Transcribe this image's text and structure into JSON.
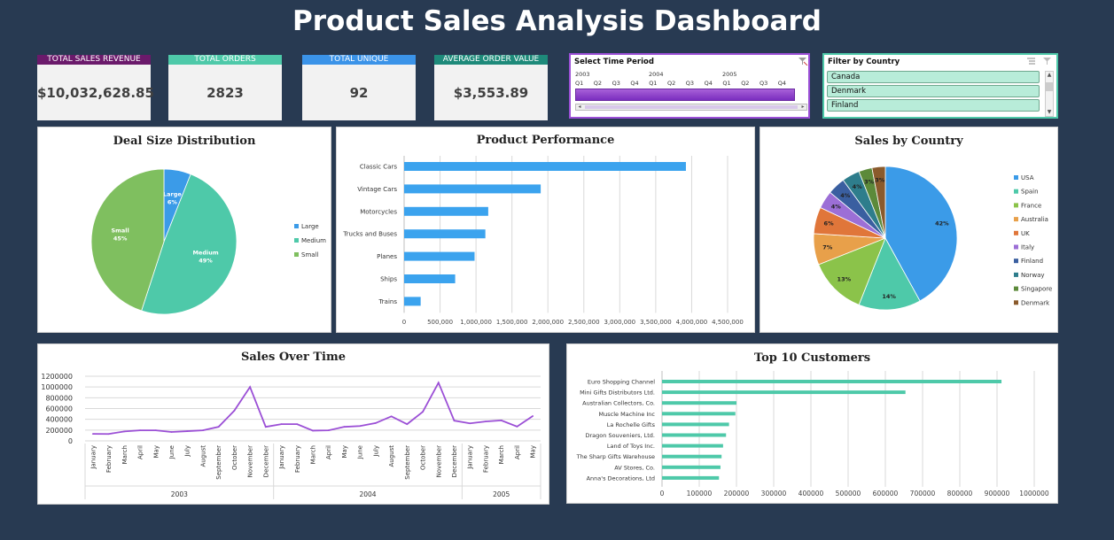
{
  "title": "Product Sales Analysis Dashboard",
  "kpis": [
    {
      "label": "TOTAL SALES REVENUE",
      "value": "$10,032,628.85",
      "color": "#6b1a6b"
    },
    {
      "label": "TOTAL ORDERS",
      "value": "2823",
      "color": "#4ec9a9"
    },
    {
      "label": "TOTAL UNIQUE",
      "value": "92",
      "color": "#3b93e8"
    },
    {
      "label": "AVERAGE ORDER VALUE",
      "value": "$3,553.89",
      "color": "#1e8a7a"
    }
  ],
  "time_slicer": {
    "title": "Select Time Period",
    "years": [
      "2003",
      "2004",
      "2005"
    ],
    "quarters": [
      "Q1",
      "Q2",
      "Q3",
      "Q4",
      "Q1",
      "Q2",
      "Q3",
      "Q4",
      "Q1",
      "Q2",
      "Q3",
      "Q4"
    ]
  },
  "country_slicer": {
    "title": "Filter by Country",
    "items": [
      "Canada",
      "Denmark",
      "Finland"
    ]
  },
  "chart_data": [
    {
      "type": "pie",
      "title": "Deal Size Distribution",
      "categories": [
        "Large",
        "Medium",
        "Small"
      ],
      "values": [
        6,
        49,
        45
      ],
      "data_labels": [
        "Large\n6%",
        "Medium\n49%",
        "Small\n45%"
      ],
      "colors": [
        "#3b9be8",
        "#4ec9a9",
        "#7fbf5f"
      ],
      "legend": "right"
    },
    {
      "type": "bar",
      "title": "Product Performance",
      "categories": [
        "Classic Cars",
        "Vintage Cars",
        "Motorcycles",
        "Trucks and Buses",
        "Planes",
        "Ships",
        "Trains"
      ],
      "values": [
        3920000,
        1900000,
        1170000,
        1130000,
        980000,
        710000,
        230000
      ],
      "xlim": [
        0,
        4500000
      ],
      "xticks": [
        "0",
        "500,000",
        "1,000,000",
        "1,500,000",
        "2,000,000",
        "2,500,000",
        "3,000,000",
        "3,500,000",
        "4,000,000",
        "4,500,000"
      ],
      "color": "#3ba3ee",
      "grid": true
    },
    {
      "type": "pie",
      "title": "Sales by Country",
      "categories": [
        "USA",
        "Spain",
        "France",
        "Australia",
        "UK",
        "Italy",
        "Finland",
        "Norway",
        "Singapore",
        "Denmark"
      ],
      "values": [
        42,
        14,
        13,
        7,
        6,
        4,
        4,
        4,
        3,
        3
      ],
      "data_labels": [
        "42%",
        "14%",
        "13%",
        "7%",
        "6%",
        "4%",
        "4%",
        "4%",
        "3%",
        "3%"
      ],
      "colors": [
        "#3b9be8",
        "#4ec9a9",
        "#8bc34a",
        "#e8a04a",
        "#e0763a",
        "#9c6fd6",
        "#3a5fa0",
        "#2e7d8c",
        "#5c8a3a",
        "#8a5a2c"
      ],
      "legend": "right"
    },
    {
      "type": "line",
      "title": "Sales Over Time",
      "x": [
        "January",
        "February",
        "March",
        "April",
        "May",
        "June",
        "July",
        "August",
        "September",
        "October",
        "November",
        "December",
        "January",
        "February",
        "March",
        "April",
        "May",
        "June",
        "July",
        "August",
        "September",
        "October",
        "November",
        "December",
        "January",
        "February",
        "March",
        "April",
        "May"
      ],
      "year_groups": [
        {
          "year": "2003",
          "count": 12
        },
        {
          "year": "2004",
          "count": 12
        },
        {
          "year": "2005",
          "count": 5
        }
      ],
      "values": [
        130000,
        128000,
        175000,
        195000,
        195000,
        165000,
        180000,
        195000,
        260000,
        560000,
        1000000,
        260000,
        310000,
        310000,
        190000,
        195000,
        260000,
        275000,
        330000,
        455000,
        310000,
        540000,
        1080000,
        375000,
        325000,
        360000,
        380000,
        265000,
        460000
      ],
      "ylim": [
        0,
        1200000
      ],
      "yticks": [
        "0",
        "200000",
        "400000",
        "600000",
        "800000",
        "1000000",
        "1200000"
      ],
      "color": "#9b4fd6",
      "grid": true
    },
    {
      "type": "bar",
      "title": "Top 10 Customers",
      "categories": [
        "Euro Shopping Channel",
        "Mini Gifts Distributors Ltd.",
        "Australian Collectors, Co.",
        "Muscle Machine Inc",
        "La Rochelle Gifts",
        "Dragon Souveniers, Ltd.",
        "Land of Toys Inc.",
        "The Sharp Gifts Warehouse",
        "AV Stores, Co.",
        "Anna's Decorations, Ltd"
      ],
      "values": [
        912000,
        654000,
        200000,
        197000,
        180000,
        172000,
        164000,
        160000,
        157000,
        153000
      ],
      "xlim": [
        0,
        1000000
      ],
      "xticks": [
        "0",
        "100000",
        "200000",
        "300000",
        "400000",
        "500000",
        "600000",
        "700000",
        "800000",
        "900000",
        "1000000"
      ],
      "color": "#4ec9a9",
      "grid": true
    }
  ]
}
